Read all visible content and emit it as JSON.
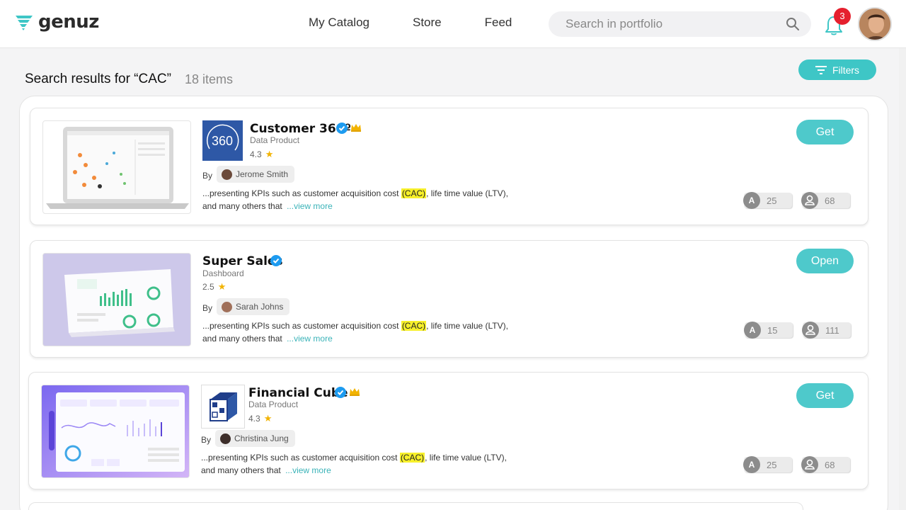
{
  "header": {
    "logo_text": "genuz",
    "nav": [
      "My Catalog",
      "Store",
      "Feed"
    ],
    "search_placeholder": "Search in portfolio",
    "notification_count": "3"
  },
  "results": {
    "title": "Search results for “CAC”",
    "count": "18 items",
    "filters_label": "Filters"
  },
  "products": [
    {
      "title": "Customer 360º",
      "type": "Data Product",
      "rating": "4.3",
      "by": "By",
      "author": "Jerome Smith",
      "desc_pre": "...presenting KPIs such as customer acquisition cost ",
      "highlight": "(CAC)",
      "desc_post": ", life time value (LTV), and many others that",
      "view_more": "...view more",
      "action": "Get",
      "stat_a": "25",
      "stat_b": "68",
      "stat_a_letter": "A"
    },
    {
      "title": "Super Sales",
      "type": "Dashboard",
      "rating": "2.5",
      "by": "By",
      "author": "Sarah Johns",
      "desc_pre": "...presenting KPIs such as customer acquisition cost ",
      "highlight": "(CAC)",
      "desc_post": ", life time value (LTV), and many others that",
      "view_more": "...view more",
      "action": "Open",
      "stat_a": "15",
      "stat_b": "111",
      "stat_a_letter": "A"
    },
    {
      "title": "Financial Cube",
      "type": "Data Product",
      "rating": "4.3",
      "by": "By",
      "author": "Christina Jung",
      "desc_pre": "...presenting KPIs such as customer acquisition cost ",
      "highlight": "(CAC)",
      "desc_post": ", life time value (LTV), and many others that",
      "view_more": "...view more",
      "action": "Get",
      "stat_a": "25",
      "stat_b": "68",
      "stat_a_letter": "A"
    }
  ],
  "icons": {
    "logo": "genuz-logo-icon",
    "search": "search-icon",
    "bell": "bell-icon",
    "filter": "filter-icon",
    "verified": "verified-badge-icon",
    "crown": "crown-icon",
    "star": "star-icon",
    "user": "user-icon"
  },
  "colors": {
    "accent": "#4ec9cb",
    "highlight": "#f7f02a",
    "badge": "#e5202e",
    "verified": "#1d9bf0"
  }
}
